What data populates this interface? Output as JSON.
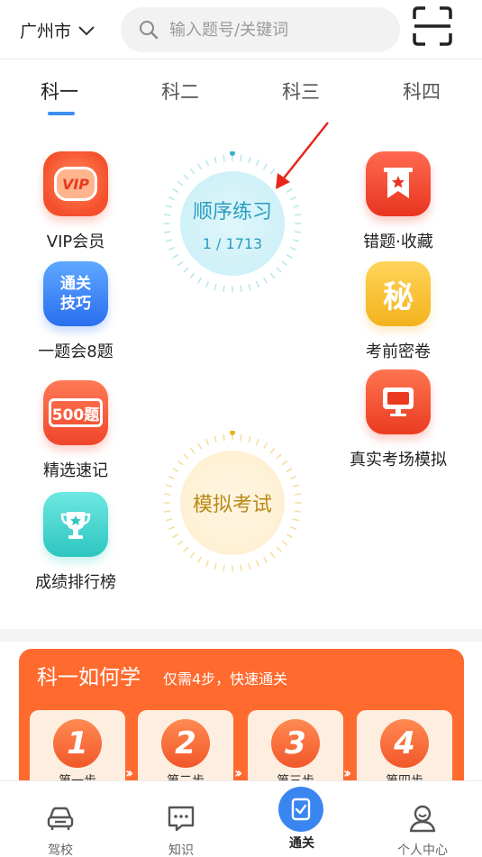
{
  "header": {
    "city": "广州市",
    "search_placeholder": "输入题号/关键词"
  },
  "tabs": [
    {
      "label": "科一",
      "active": true
    },
    {
      "label": "科二"
    },
    {
      "label": "科三"
    },
    {
      "label": "科四"
    }
  ],
  "left_features": [
    {
      "label": "VIP会员",
      "icon": "vip-icon",
      "badge": "VIP"
    },
    {
      "label": "一题会8题",
      "icon": "tips-icon",
      "badge_line1": "通关",
      "badge_line2": "技巧"
    },
    {
      "label": "精选速记",
      "icon": "500-questions-icon",
      "badge": "500题"
    },
    {
      "label": "成绩排行榜",
      "icon": "trophy-icon"
    }
  ],
  "right_features": [
    {
      "label": "错题·收藏",
      "icon": "bookmark-star-icon"
    },
    {
      "label": "考前密卷",
      "icon": "secret-icon",
      "badge": "秘"
    },
    {
      "label": "真实考场模拟",
      "icon": "monitor-icon"
    }
  ],
  "practice": {
    "title": "顺序练习",
    "progress": "1 / 1713",
    "accent": "#2a9cc0"
  },
  "mock_exam": {
    "title": "模拟考试",
    "accent": "#b88a18"
  },
  "study": {
    "title": "科一如何学",
    "subtitle": "仅需4步，快速通关",
    "bg": "#ff6a2f",
    "steps": [
      {
        "num": "1",
        "label": "第一步"
      },
      {
        "num": "2",
        "label": "第二步"
      },
      {
        "num": "3",
        "label": "第三步"
      },
      {
        "num": "4",
        "label": "第四步"
      }
    ]
  },
  "bottom_nav": [
    {
      "label": "驾校",
      "icon": "car-icon"
    },
    {
      "label": "知识",
      "icon": "chat-icon"
    },
    {
      "label": "通关",
      "icon": "pass-check-icon",
      "active": true
    },
    {
      "label": "个人中心",
      "icon": "user-icon"
    }
  ]
}
